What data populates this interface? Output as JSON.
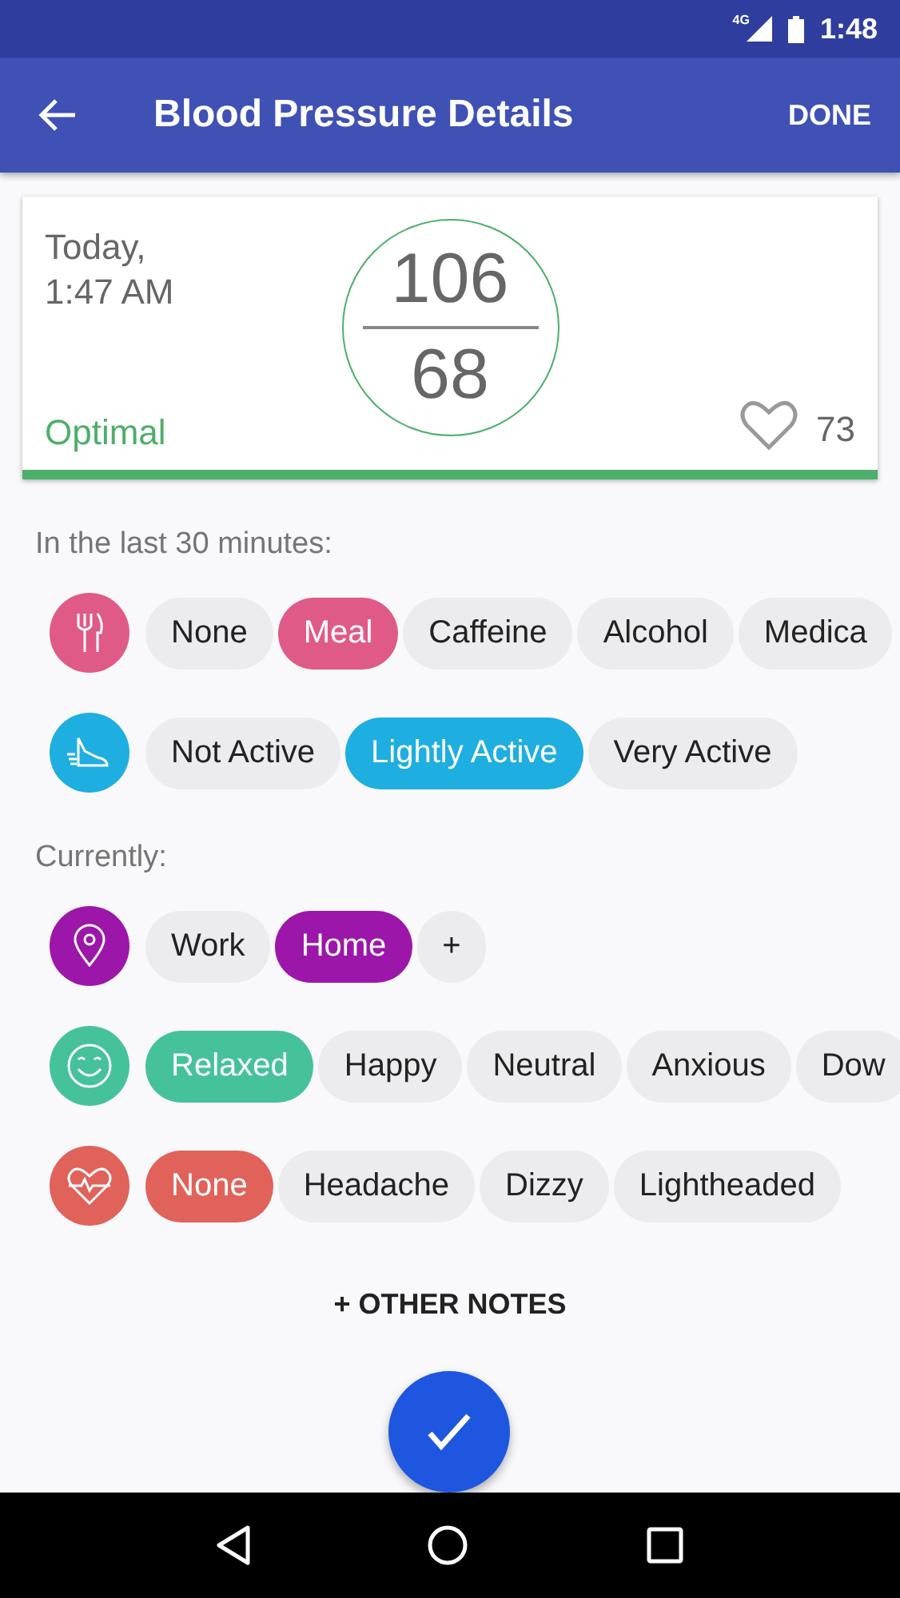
{
  "status_bar": {
    "network": "4G",
    "time": "1:48"
  },
  "app_bar": {
    "title": "Blood Pressure Details",
    "action": "DONE"
  },
  "reading": {
    "date": "Today,",
    "time": "1:47 AM",
    "systolic": "106",
    "diastolic": "68",
    "category": "Optimal",
    "color": "#4caf6a",
    "pulse": "73"
  },
  "sections": [
    {
      "label": "In the last 30 minutes:",
      "rows": [
        {
          "kind": "meal",
          "color": "#e05a87",
          "chips": [
            {
              "label": "None",
              "selected": false
            },
            {
              "label": "Meal",
              "selected": true
            },
            {
              "label": "Caffeine",
              "selected": false
            },
            {
              "label": "Alcohol",
              "selected": false
            },
            {
              "label": "Medica",
              "selected": false
            }
          ]
        },
        {
          "kind": "activity",
          "color": "#1eaee0",
          "chips": [
            {
              "label": "Not Active",
              "selected": false
            },
            {
              "label": "Lightly Active",
              "selected": true
            },
            {
              "label": "Very Active",
              "selected": false
            }
          ]
        }
      ]
    },
    {
      "label": "Currently:",
      "rows": [
        {
          "kind": "location",
          "color": "#9c16aa",
          "chips": [
            {
              "label": "Work",
              "selected": false
            },
            {
              "label": "Home",
              "selected": true
            },
            {
              "label": "+",
              "selected": false
            }
          ]
        },
        {
          "kind": "mood",
          "color": "#45c29b",
          "chips": [
            {
              "label": "Relaxed",
              "selected": true
            },
            {
              "label": "Happy",
              "selected": false
            },
            {
              "label": "Neutral",
              "selected": false
            },
            {
              "label": "Anxious",
              "selected": false
            },
            {
              "label": "Dow",
              "selected": false
            }
          ]
        },
        {
          "kind": "symptom",
          "color": "#e0625a",
          "chips": [
            {
              "label": "None",
              "selected": true
            },
            {
              "label": "Headache",
              "selected": false
            },
            {
              "label": "Dizzy",
              "selected": false
            },
            {
              "label": "Lightheaded",
              "selected": false
            }
          ]
        }
      ]
    }
  ],
  "other_notes": "+ OTHER NOTES"
}
